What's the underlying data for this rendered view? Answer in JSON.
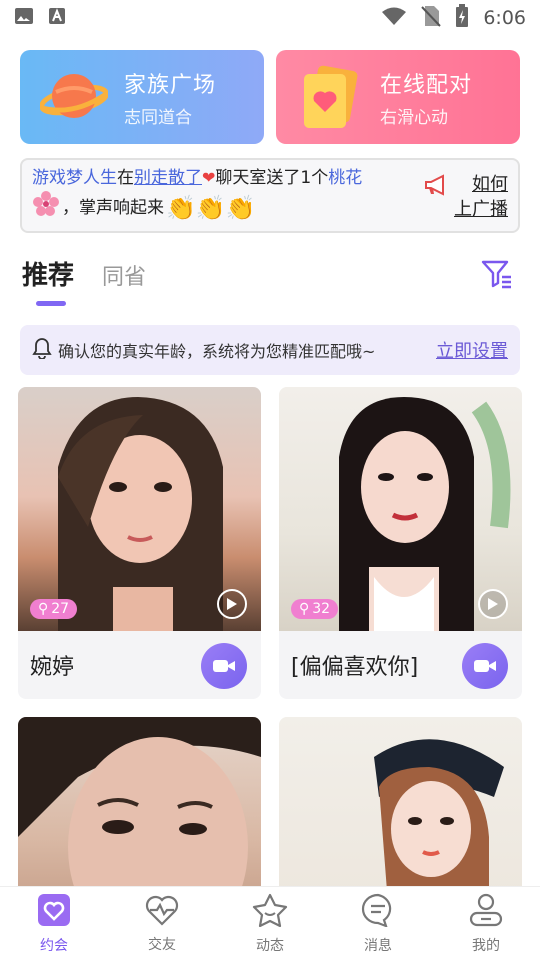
{
  "status_bar": {
    "time": "6:06",
    "icons": [
      "image-icon",
      "text-a-icon",
      "wifi-icon",
      "no-sim-icon",
      "battery-icon"
    ]
  },
  "top_cards": [
    {
      "title": "家族广场",
      "subtitle": "志同道合",
      "icon": "planet-icon",
      "color": "#7ab2f6"
    },
    {
      "title": "在线配对",
      "subtitle": "右滑心动",
      "icon": "heart-card-icon",
      "color": "#ff7e9c"
    }
  ],
  "broadcast": {
    "user": "游戏梦人生",
    "at": "在",
    "room": "别走散了",
    "action": "聊天室送了1个",
    "gift": "桃花",
    "cheer": "，掌声响起来",
    "how_line1": "如何",
    "how_line2": "上广播"
  },
  "tabs": {
    "active": "推荐",
    "inactive": "同省"
  },
  "notice": {
    "text": "确认您的真实年龄，系统将为您精准匹配哦~",
    "link": "立即设置"
  },
  "cards": [
    {
      "name": "婉婷",
      "badge": "27"
    },
    {
      "name": "[偏偏喜欢你]",
      "badge": "32"
    },
    {
      "name": "",
      "badge": ""
    },
    {
      "name": "",
      "badge": ""
    }
  ],
  "bottom_nav": [
    {
      "label": "约会",
      "icon": "heart-box-icon",
      "active": true
    },
    {
      "label": "交友",
      "icon": "heartbeat-icon",
      "active": false
    },
    {
      "label": "动态",
      "icon": "star-icon",
      "active": false
    },
    {
      "label": "消息",
      "icon": "chat-bubble-icon",
      "active": false
    },
    {
      "label": "我的",
      "icon": "profile-icon",
      "active": false
    }
  ],
  "colors": {
    "accent": "#7a57ee",
    "link_blue": "#4a67dc",
    "badge_pink": "#f07fd0",
    "notice_bg": "#efecfb"
  }
}
